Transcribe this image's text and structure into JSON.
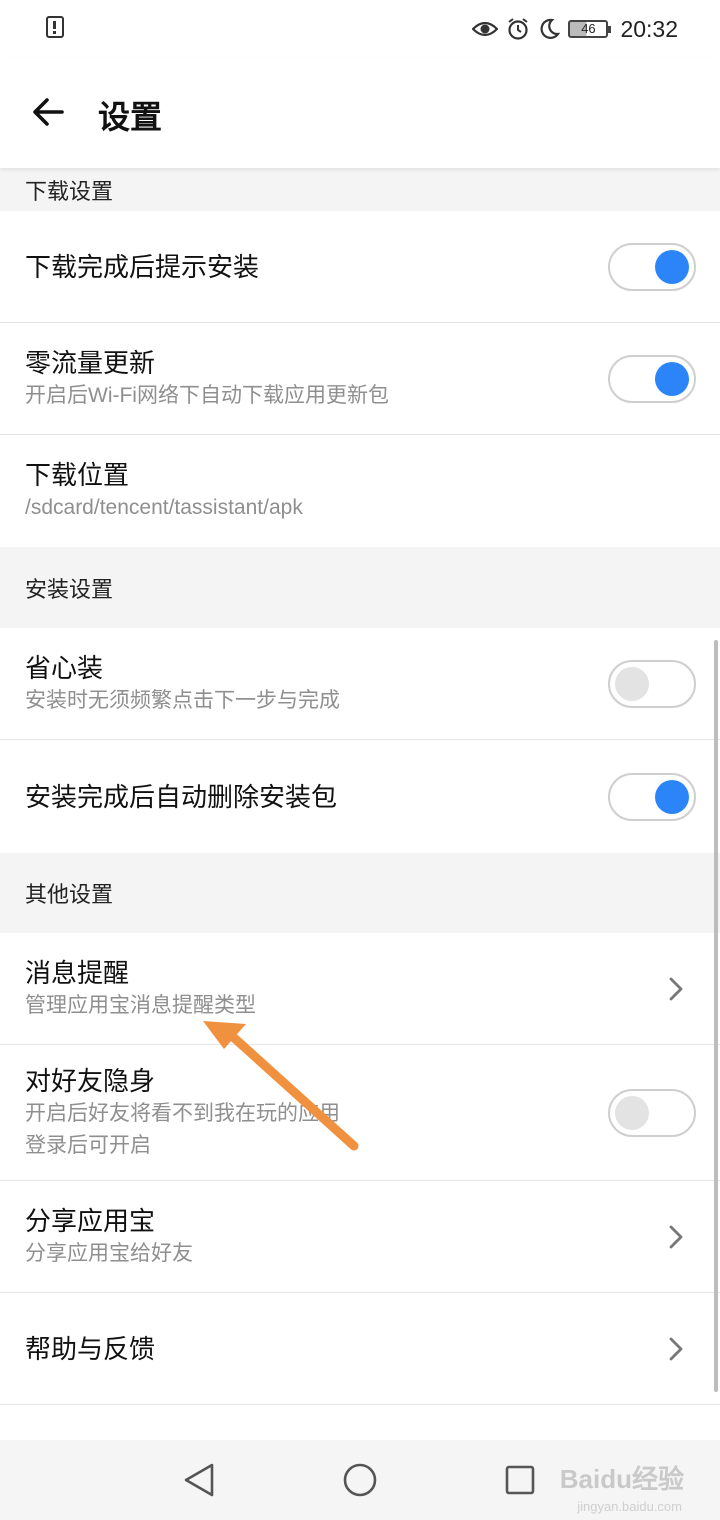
{
  "status_bar": {
    "time": "20:32",
    "battery": "46"
  },
  "app_bar": {
    "title": "设置"
  },
  "sections": {
    "download": {
      "header": "下载设置",
      "items": [
        {
          "title": "下载完成后提示安装",
          "toggle": "on"
        },
        {
          "title": "零流量更新",
          "subtitle": "开启后Wi-Fi网络下自动下载应用更新包",
          "toggle": "on"
        },
        {
          "title": "下载位置",
          "subtitle": "/sdcard/tencent/tassistant/apk"
        }
      ]
    },
    "install": {
      "header": "安装设置",
      "items": [
        {
          "title": "省心装",
          "subtitle": "安装时无须频繁点击下一步与完成",
          "toggle": "off"
        },
        {
          "title": "安装完成后自动删除安装包",
          "toggle": "on"
        }
      ]
    },
    "other": {
      "header": "其他设置",
      "items": [
        {
          "title": "消息提醒",
          "subtitle": "管理应用宝消息提醒类型"
        },
        {
          "title": "对好友隐身",
          "subtitle": "开启后好友将看不到我在玩的应用",
          "subtitle2": "登录后可开启",
          "toggle": "off"
        },
        {
          "title": "分享应用宝",
          "subtitle": "分享应用宝给好友"
        },
        {
          "title": "帮助与反馈"
        }
      ]
    }
  },
  "watermark": {
    "text": "Baidu经验",
    "sub": "jingyan.baidu.com"
  },
  "colors": {
    "accent": "#2b84f8",
    "annotation": "#f0913f"
  }
}
